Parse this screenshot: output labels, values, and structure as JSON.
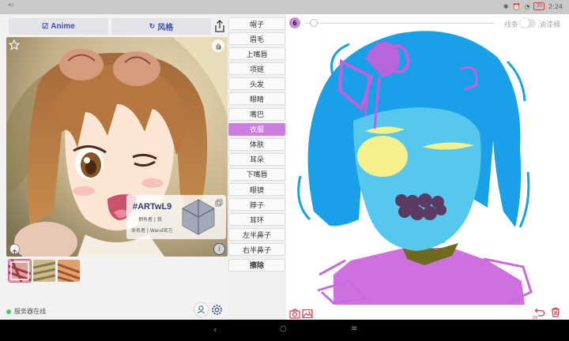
{
  "status_bar": {
    "signal": "⁴ᴳ",
    "battery": "30",
    "time": "2:24"
  },
  "toolbar": {
    "anime_label": "Anime",
    "style_label": "风格"
  },
  "card": {
    "id": "#ARTwL9",
    "owner": "拥有者 | 我",
    "namer": "命名者 | Wand官方"
  },
  "parts": [
    {
      "label": "帽子"
    },
    {
      "label": "眉毛"
    },
    {
      "label": "上嘴唇"
    },
    {
      "label": "项链"
    },
    {
      "label": "头发"
    },
    {
      "label": "眼睛"
    },
    {
      "label": "嘴巴"
    },
    {
      "label": "衣服",
      "active": true
    },
    {
      "label": "体肤"
    },
    {
      "label": "耳朵"
    },
    {
      "label": "下嘴唇"
    },
    {
      "label": "眼镜"
    },
    {
      "label": "脖子"
    },
    {
      "label": "耳环"
    },
    {
      "label": "左半鼻子"
    },
    {
      "label": "右半鼻子"
    },
    {
      "label": "擦除"
    }
  ],
  "canvas": {
    "brush_size": "6",
    "line_label": "线条",
    "bucket_label": "油漆桶",
    "undo_count": "20"
  },
  "footer": {
    "server_status": "服务器在线"
  },
  "colors": {
    "accent_purple": "#cc7ee0",
    "hair_blue": "#1aa0e8",
    "face_blue": "#56c8f0",
    "eye_yellow": "#f5f08a",
    "mouth": "#5a3a62",
    "neck_olive": "#6e6a1e",
    "clothes_purple": "#cf6fe0",
    "button_blue": "#3a4fb0"
  },
  "icons": {
    "anime": "checkbox-icon",
    "style": "rotate-icon",
    "share": "share-icon",
    "favorite": "star-icon",
    "info": "info-icon",
    "camera": "camera-icon",
    "gallery": "image-icon",
    "undo": "undo-icon",
    "trash": "trash-icon",
    "user": "user-icon",
    "settings": "gear-icon"
  }
}
